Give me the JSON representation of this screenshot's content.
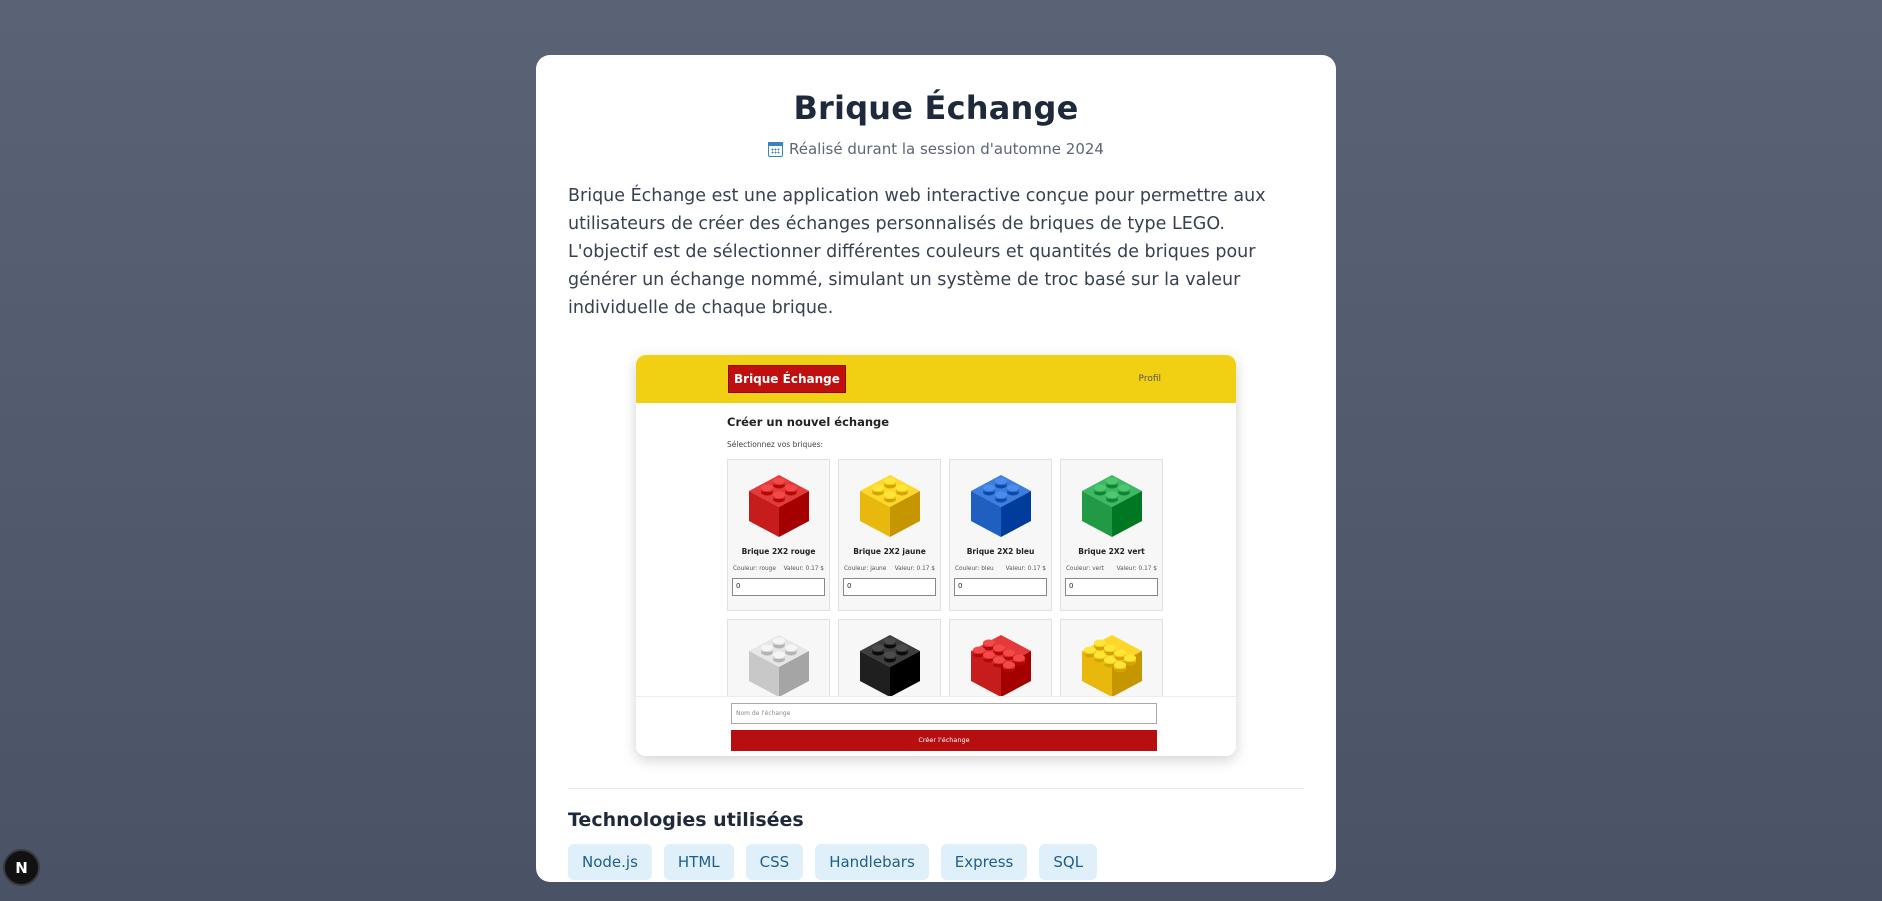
{
  "project": {
    "title": "Brique Échange",
    "subtitle": "Réalisé durant la session d'automne 2024",
    "description": "Brique Échange est une application web interactive conçue pour permettre aux utilisateurs de créer des échanges personnalisés de briques de type LEGO. L'objectif est de sélectionner différentes couleurs et quantités de briques pour générer un échange nommé, simulant un système de troc basé sur la valeur individuelle de chaque brique."
  },
  "screenshot": {
    "logo": "Brique Échange",
    "profile": "Profil",
    "heading": "Créer un nouvel échange",
    "select_label": "Sélectionnez vos briques:",
    "bricks": [
      {
        "name": "Brique 2X2 rouge",
        "color_label": "Couleur: rouge",
        "value_label": "Valeur: 0.17 $",
        "qty": "0",
        "hex": "#c71c1c"
      },
      {
        "name": "Brique 2X2 jaune",
        "color_label": "Couleur: jaune",
        "value_label": "Valeur: 0.17 $",
        "qty": "0",
        "hex": "#e8b90c"
      },
      {
        "name": "Brique 2X2 bleu",
        "color_label": "Couleur: bleu",
        "value_label": "Valeur: 0.17 $",
        "qty": "0",
        "hex": "#1e5fbf"
      },
      {
        "name": "Brique 2X2 vert",
        "color_label": "Couleur: vert",
        "value_label": "Valeur: 0.17 $",
        "qty": "0",
        "hex": "#229a45"
      }
    ],
    "bricks_row2": [
      {
        "hex": "#c8c8c8"
      },
      {
        "hex": "#1f1f1f"
      },
      {
        "hex": "#c71c1c"
      },
      {
        "hex": "#e8b90c"
      }
    ],
    "name_placeholder": "Nom de l'échange",
    "create_button": "Créer l'échange"
  },
  "tech": {
    "title": "Technologies utilisées",
    "tags": [
      "Node.js",
      "HTML",
      "CSS",
      "Handlebars",
      "Express",
      "SQL"
    ]
  },
  "badge": {
    "label": "N"
  }
}
